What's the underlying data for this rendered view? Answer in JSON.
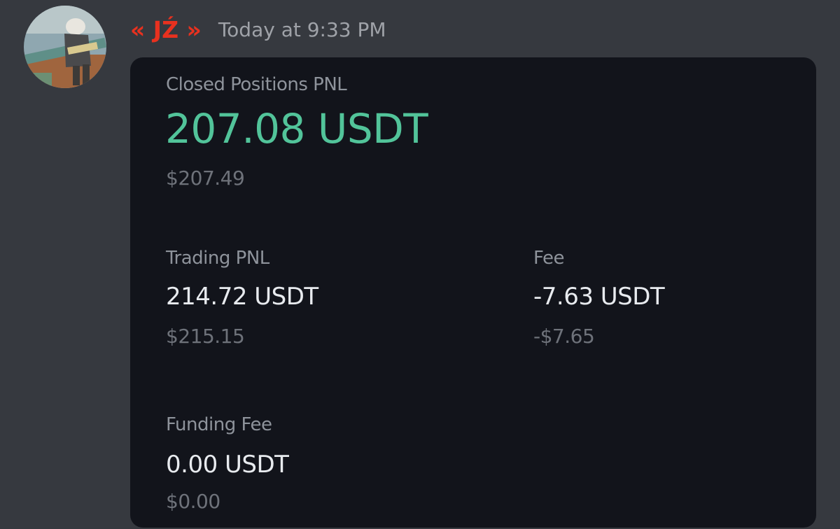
{
  "message": {
    "author": "« JŹ »",
    "timestamp": "Today at 9:33 PM",
    "author_color": "#e8311f"
  },
  "pnl_card": {
    "closed_positions_pnl": {
      "label": "Closed Positions PNL",
      "value": "207.08 USDT",
      "fiat": "$207.49",
      "value_color": "#52c49a"
    },
    "trading_pnl": {
      "label": "Trading PNL",
      "value": "214.72 USDT",
      "fiat": "$215.15"
    },
    "fee": {
      "label": "Fee",
      "value": "-7.63 USDT",
      "fiat": "-$7.65"
    },
    "funding_fee": {
      "label": "Funding Fee",
      "value": "0.00 USDT",
      "fiat": "$0.00"
    }
  },
  "colors": {
    "background": "#36393f",
    "card": "#12141b",
    "positive": "#52c49a"
  }
}
